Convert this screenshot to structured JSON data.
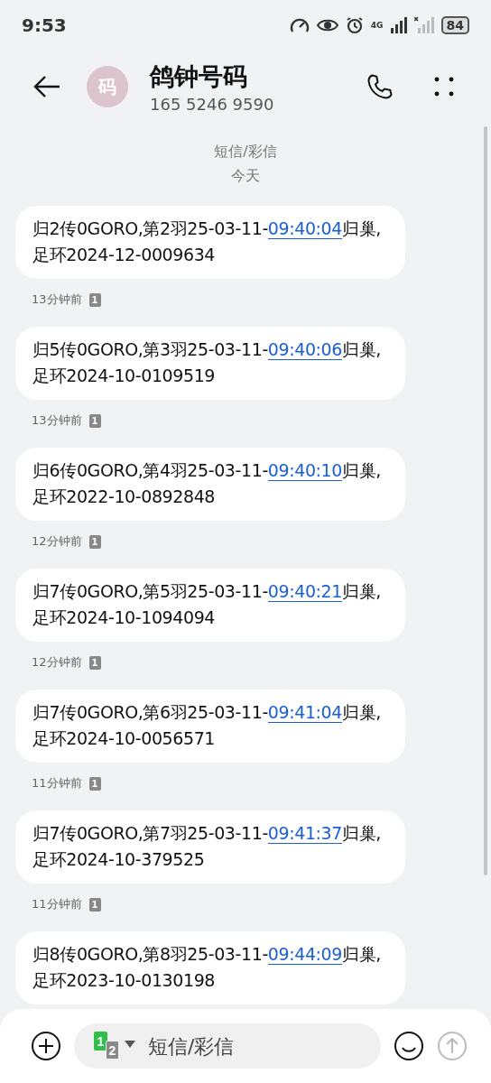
{
  "status_bar": {
    "time": "9:53",
    "network": "4G",
    "battery": "84"
  },
  "header": {
    "avatar": "码",
    "name": "鸽钟号码",
    "number": "165 5246 9590"
  },
  "thread_label": "短信/彩信",
  "date": "今天",
  "messages": [
    {
      "before": "归2传0GORO,第2羽25-03-11-",
      "link": "09:40:04",
      "after": "归巢,足环2024-12-0009634",
      "time": "13分钟前",
      "sim": "1"
    },
    {
      "before": "归5传0GORO,第3羽25-03-11-",
      "link": "09:40:06",
      "after": "归巢,足环2024-10-0109519",
      "time": "13分钟前",
      "sim": "1"
    },
    {
      "before": "归6传0GORO,第4羽25-03-11-",
      "link": "09:40:10",
      "after": "归巢,足环2022-10-0892848",
      "time": "12分钟前",
      "sim": "1"
    },
    {
      "before": "归7传0GORO,第5羽25-03-11-",
      "link": "09:40:21",
      "after": "归巢,足环2024-10-1094094",
      "time": "12分钟前",
      "sim": "1"
    },
    {
      "before": "归7传0GORO,第6羽25-03-11-",
      "link": "09:41:04",
      "after": "归巢,足环2024-10-0056571",
      "time": "11分钟前",
      "sim": "1"
    },
    {
      "before": "归7传0GORO,第7羽25-03-11-",
      "link": "09:41:37",
      "after": "归巢,足环2024-10-379525",
      "time": "11分钟前",
      "sim": "1"
    },
    {
      "before": "归8传0GORO,第8羽25-03-11-",
      "link": "09:44:09",
      "after": "归巢,足环2023-10-0130198"
    }
  ],
  "composer": {
    "sim_primary": "1",
    "sim_secondary": "2",
    "placeholder": "短信/彩信"
  }
}
